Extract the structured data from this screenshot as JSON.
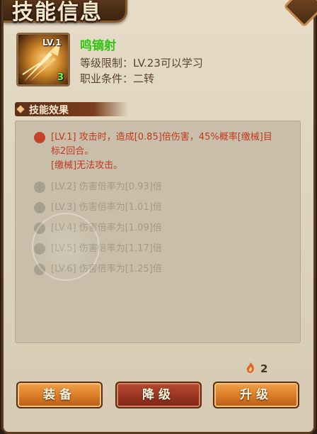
{
  "header": {
    "title": "技能信息"
  },
  "skill": {
    "icon_level": "LV.1",
    "icon_count": "3",
    "name": "鸣镝射",
    "level_req": "等级限制：LV.23可以学习",
    "job_req": "职业条件：二转"
  },
  "effects": {
    "section_title": "技能效果",
    "active": {
      "line1": "[LV.1] 攻击时，造成[0.85]倍伤害，45%概率[缴械]目",
      "line2": "标2回合。",
      "line3": "[缴械]无法攻击。"
    },
    "levels": [
      {
        "text": "[LV.2] 伤害倍率为[0.93]倍"
      },
      {
        "text": "[LV.3] 伤害倍率为[1.01]倍"
      },
      {
        "text": "[LV.4] 伤害倍率为[1.09]倍"
      },
      {
        "text": "[LV.5] 伤害倍率为[1.17]倍"
      },
      {
        "text": "[LV.6] 伤害倍率为[1.25]倍"
      }
    ]
  },
  "currency": {
    "icon": "scroll-fire-icon",
    "count": "2"
  },
  "buttons": {
    "equip": "装备",
    "downgrade": "降级",
    "upgrade": "升级"
  },
  "colors": {
    "skill_name": "#3ac21a",
    "active_effect": "#c3381e",
    "inactive_effect": "#a39a88",
    "button_orange": "#d97b26",
    "button_red": "#9a3522"
  }
}
